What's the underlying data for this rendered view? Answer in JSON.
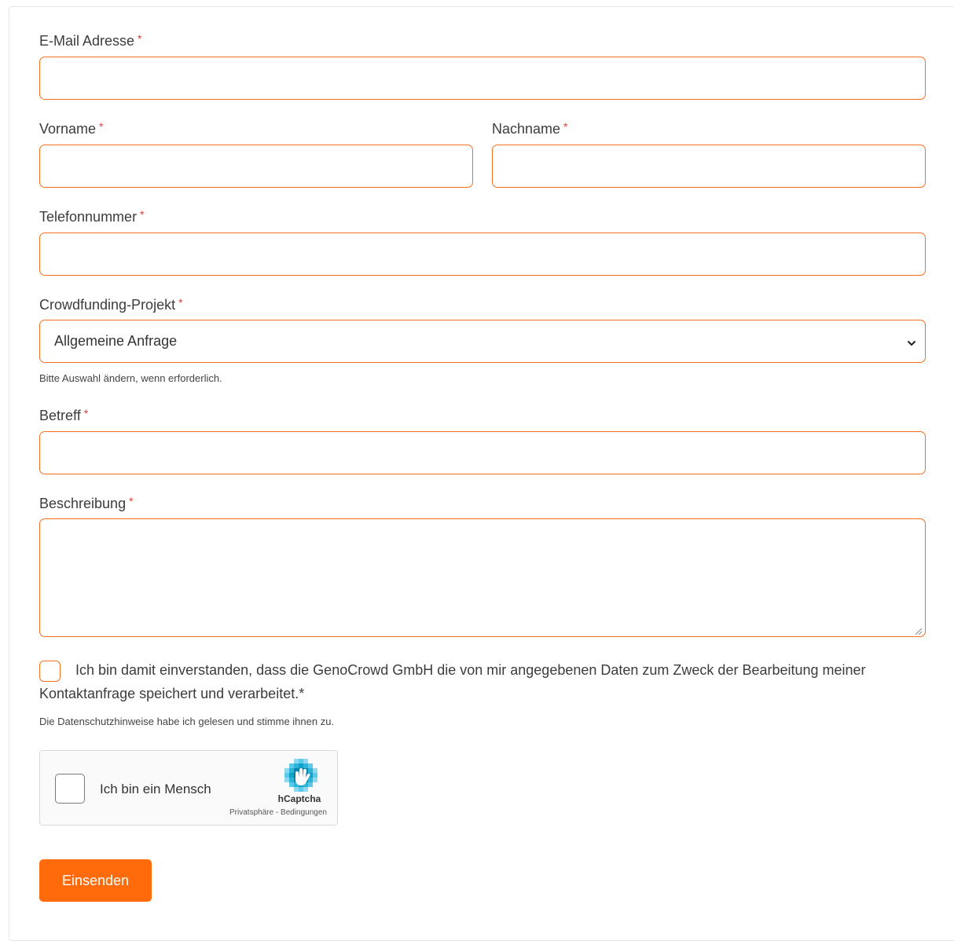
{
  "form": {
    "email": {
      "label": "E-Mail Adresse",
      "required_mark": "*",
      "value": ""
    },
    "first_name": {
      "label": "Vorname",
      "required_mark": "*",
      "value": ""
    },
    "last_name": {
      "label": "Nachname",
      "required_mark": "*",
      "value": ""
    },
    "phone": {
      "label": "Telefonnummer",
      "required_mark": "*",
      "value": ""
    },
    "project": {
      "label": "Crowdfunding-Projekt",
      "required_mark": "*",
      "selected": "Allgemeine Anfrage",
      "help": "Bitte Auswahl ändern, wenn erforderlich."
    },
    "subject": {
      "label": "Betreff",
      "required_mark": "*",
      "value": ""
    },
    "description": {
      "label": "Beschreibung",
      "required_mark": "*",
      "value": ""
    },
    "consent": {
      "text": "Ich bin damit einverstanden, dass die GenoCrowd GmbH die von mir angegebenen Daten zum Zweck der Bearbeitung meiner Kontaktanfrage speichert und verarbeitet.*",
      "privacy_note": "Die Datenschutzhinweise habe ich gelesen und stimme ihnen zu.",
      "checked": false
    },
    "captcha": {
      "label": "Ich bin ein Mensch",
      "brand": "hCaptcha",
      "privacy_link": "Privatsphäre",
      "separator": " - ",
      "terms_link": "Bedingungen"
    },
    "submit_label": "Einsenden"
  },
  "colors": {
    "accent": "#f37021",
    "button": "#ff6b0a",
    "required": "#e53935"
  },
  "icons": {
    "select_arrow": "chevron-down-icon",
    "captcha_logo": "hcaptcha-logo-icon",
    "textarea_resize": "resize-grip-icon"
  }
}
